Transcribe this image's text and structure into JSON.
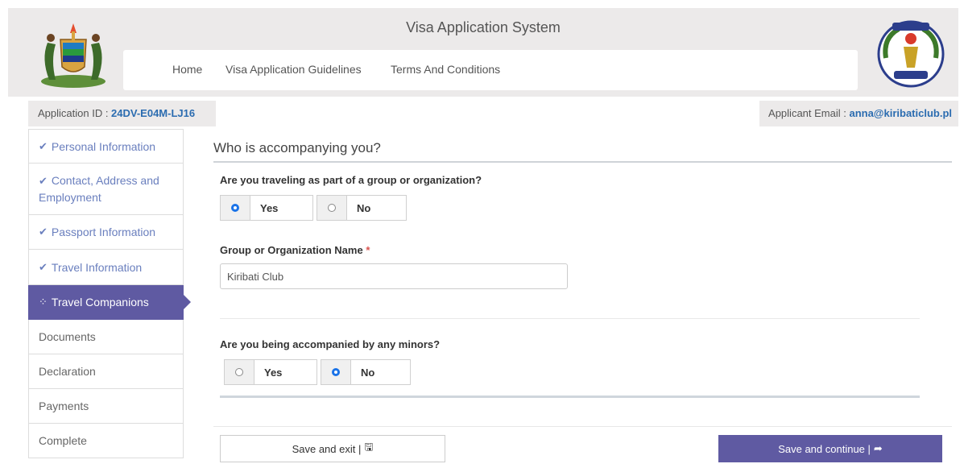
{
  "header": {
    "title": "Visa Application System",
    "nav": [
      "Home",
      "Visa Application Guidelines",
      "Terms And Conditions"
    ],
    "logo_left": "tanzania-coat-of-arms",
    "logo_right": "tanzania-immigration-emblem"
  },
  "info": {
    "app_id_label": "Application ID : ",
    "app_id": "24DV-E04M-LJ16",
    "email_label": "Applicant Email : ",
    "email": "anna@kiribaticlub.pl"
  },
  "sidebar": {
    "items": [
      {
        "label": "Personal Information",
        "state": "done",
        "icon": "check-icon"
      },
      {
        "label": "Contact, Address and Employment",
        "state": "done",
        "icon": "check-icon"
      },
      {
        "label": "Passport Information",
        "state": "done",
        "icon": "check-icon"
      },
      {
        "label": "Travel Information",
        "state": "done",
        "icon": "check-icon"
      },
      {
        "label": "Travel Companions",
        "state": "active",
        "icon": "spinner-icon"
      },
      {
        "label": "Documents",
        "state": "pending"
      },
      {
        "label": "Declaration",
        "state": "pending"
      },
      {
        "label": "Payments",
        "state": "pending"
      },
      {
        "label": "Complete",
        "state": "pending"
      }
    ]
  },
  "form": {
    "title": "Who is accompanying you?",
    "q1": {
      "label": "Are you traveling as part of a group or organization?",
      "options": [
        "Yes",
        "No"
      ],
      "selected": "Yes"
    },
    "group_name": {
      "label": "Group or Organization Name",
      "required_mark": "*",
      "value": "Kiribati Club"
    },
    "q2": {
      "label": "Are you being accompanied by any minors?",
      "options": [
        "Yes",
        "No"
      ],
      "selected": "No"
    },
    "save_exit": "Save and exit | ",
    "save_continue": "Save and continue | "
  },
  "colors": {
    "accent": "#5f5aa2",
    "link": "#6a7fbe",
    "id_blue": "#2b6cb0",
    "radio_on": "#1a73e8"
  }
}
